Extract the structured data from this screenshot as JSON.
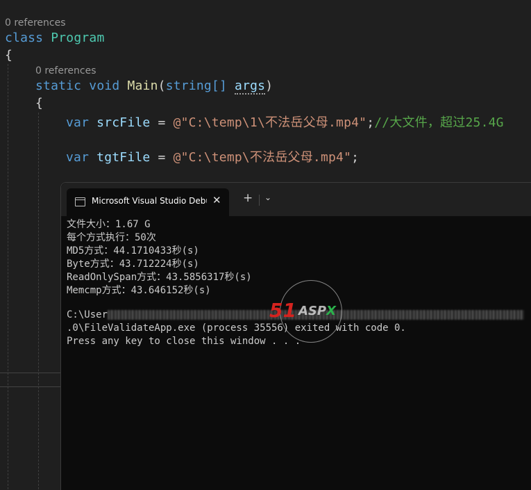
{
  "editor": {
    "codelens_class": "0 references",
    "codelens_main": "0 references",
    "line_class": {
      "keyword": "class",
      "name": "Program"
    },
    "line_open_brace": "{",
    "line_main": {
      "static": "static",
      "void": "void",
      "name": "Main",
      "open": "(",
      "type": "string[]",
      "param": "args",
      "close": ")"
    },
    "line_open_brace2": "{",
    "line_src": {
      "var": "var",
      "name": "srcFile",
      "eq": " = ",
      "value": "@\"C:\\temp\\1\\不法岳父母.mp4\"",
      "semi": ";",
      "comment": "//大文件，超过25.4G"
    },
    "line_tgt": {
      "var": "var",
      "name": "tgtFile",
      "eq": " = ",
      "value": "@\"C:\\temp\\不法岳父母.mp4\"",
      "semi": ";"
    }
  },
  "terminal": {
    "tab_title": "Microsoft Visual Studio Debug Console",
    "new_tab": "+",
    "dropdown": "⌄",
    "close": "✕",
    "lines": [
      "文件大小：1.67 G",
      "每个方式执行：50次",
      "MD5方式：44.1710433秒(s)",
      "Byte方式：43.712224秒(s)",
      "ReadOnlySpan方式：43.5856317秒(s)",
      "Memcmp方式：43.646152秒(s)"
    ],
    "path_prefix": "C:\\User",
    "exit_line": ".0\\FileValidateApp.exe (process 35556) exited with code 0.",
    "press_line": "Press any key to close this window . . ."
  },
  "watermark": {
    "brand_num": "51",
    "brand_text": "ASP",
    "brand_x": "X"
  }
}
